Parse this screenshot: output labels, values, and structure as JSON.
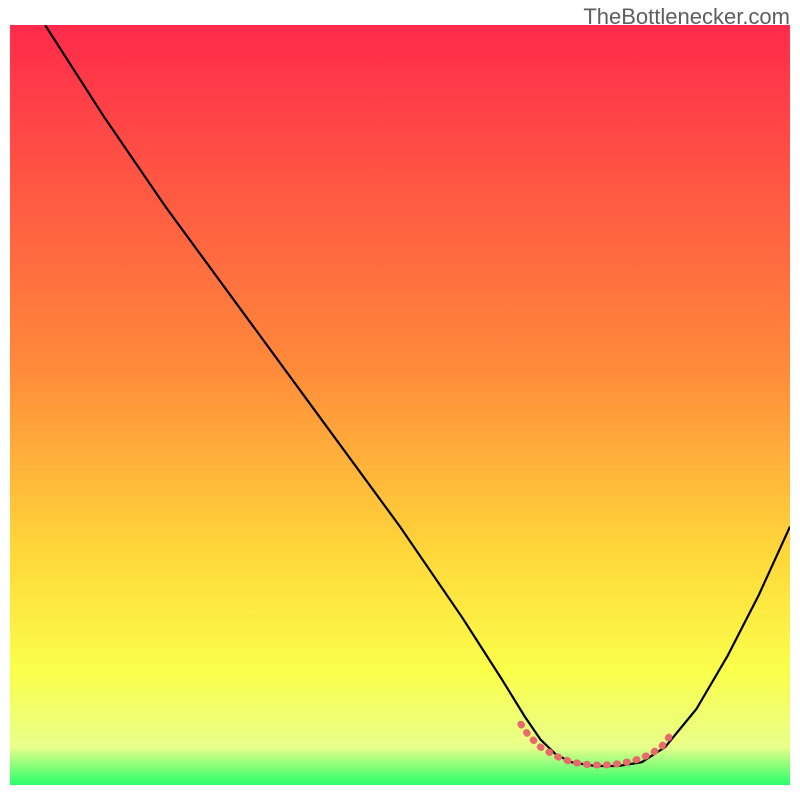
{
  "watermark": "TheBottlenecker.com",
  "chart_data": {
    "type": "line",
    "title": "",
    "xlabel": "",
    "ylabel": "",
    "xlim": [
      0,
      100
    ],
    "ylim": [
      0,
      100
    ],
    "gradient_stops": [
      {
        "offset": 0,
        "color": "#ff2a4b"
      },
      {
        "offset": 45,
        "color": "#ff8a3a"
      },
      {
        "offset": 70,
        "color": "#ffd93a"
      },
      {
        "offset": 85,
        "color": "#faff4a"
      },
      {
        "offset": 95,
        "color": "#e8ff8a"
      },
      {
        "offset": 100,
        "color": "#2aff6a"
      }
    ],
    "series": [
      {
        "name": "bottleneck-curve",
        "color": "#000000",
        "width": 2.2,
        "points": [
          {
            "x": 4.5,
            "y": 100
          },
          {
            "x": 7,
            "y": 96
          },
          {
            "x": 12,
            "y": 88
          },
          {
            "x": 20,
            "y": 76
          },
          {
            "x": 30,
            "y": 62
          },
          {
            "x": 40,
            "y": 48
          },
          {
            "x": 50,
            "y": 34
          },
          {
            "x": 58,
            "y": 22
          },
          {
            "x": 63,
            "y": 14
          },
          {
            "x": 66,
            "y": 9
          },
          {
            "x": 68,
            "y": 6
          },
          {
            "x": 70,
            "y": 4
          },
          {
            "x": 72,
            "y": 3
          },
          {
            "x": 75,
            "y": 2.5
          },
          {
            "x": 78,
            "y": 2.5
          },
          {
            "x": 81,
            "y": 3
          },
          {
            "x": 84,
            "y": 5
          },
          {
            "x": 88,
            "y": 10
          },
          {
            "x": 92,
            "y": 17
          },
          {
            "x": 96,
            "y": 25
          },
          {
            "x": 100,
            "y": 34
          }
        ]
      },
      {
        "name": "valley-highlight",
        "color": "#e86a6a",
        "width": 7,
        "points": [
          {
            "x": 65.5,
            "y": 8
          },
          {
            "x": 66.5,
            "y": 6.5
          },
          {
            "x": 68,
            "y": 5
          },
          {
            "x": 70,
            "y": 3.8
          },
          {
            "x": 72,
            "y": 3
          },
          {
            "x": 74,
            "y": 2.7
          },
          {
            "x": 76,
            "y": 2.6
          },
          {
            "x": 78,
            "y": 2.8
          },
          {
            "x": 80,
            "y": 3.2
          },
          {
            "x": 82,
            "y": 4
          },
          {
            "x": 83.5,
            "y": 5
          },
          {
            "x": 85,
            "y": 7
          }
        ]
      }
    ]
  }
}
